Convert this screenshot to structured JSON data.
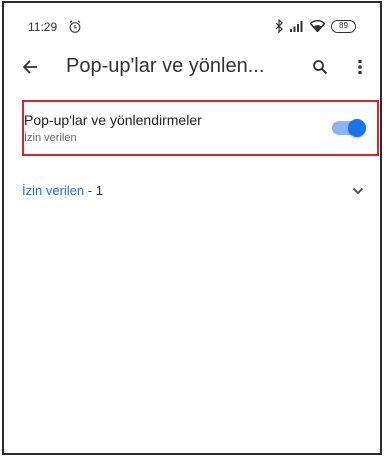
{
  "status_bar": {
    "time": "11:29",
    "battery": "89",
    "icons": [
      "alarm-icon",
      "bluetooth-icon",
      "signal-icon",
      "wifi-icon",
      "battery-icon"
    ]
  },
  "app_bar": {
    "title": "Pop-up'lar ve yönlen...",
    "icons": [
      "back-arrow-icon",
      "search-icon",
      "more-vert-icon"
    ]
  },
  "setting": {
    "title": "Pop-up'lar ve yönlendirmeler",
    "subtitle": "İzin verilen",
    "toggle_on": true
  },
  "exceptions": {
    "label": "İzin verilen",
    "separator": " - ",
    "count": "1",
    "icon": "chevron-down-icon"
  },
  "colors": {
    "accent": "#1a73e8",
    "toggle_track": "#8ab4f8",
    "highlight_border": "#d9232d",
    "text_primary": "#222222",
    "text_secondary": "#666666"
  }
}
